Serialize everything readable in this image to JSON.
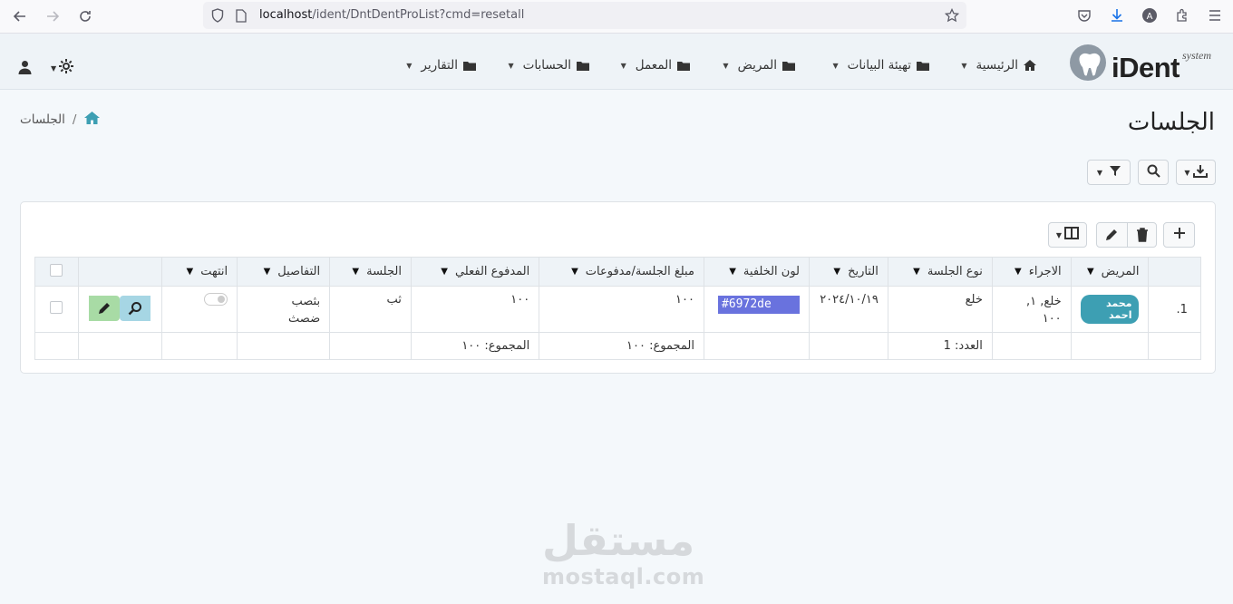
{
  "browser": {
    "url_host": "localhost",
    "url_path": "/ident/DntDentProList?cmd=resetall"
  },
  "app": {
    "logo_text": "iDent",
    "logo_sup": "system",
    "menu": [
      {
        "label": "الرئيسية"
      },
      {
        "label": "تهيئة البيانات"
      },
      {
        "label": "المريض"
      },
      {
        "label": "المعمل"
      },
      {
        "label": "الحسابات"
      },
      {
        "label": "التقارير"
      }
    ]
  },
  "page": {
    "title": "الجلسات",
    "breadcrumb_current": "الجلسات",
    "breadcrumb_sep": "/"
  },
  "table": {
    "columns": [
      "المريض",
      "الاجراء",
      "نوع الجلسة",
      "التاريخ",
      "لون الخلفية",
      "مبلغ الجلسة/مدفوعات",
      "المدفوع الفعلي",
      "الجلسة",
      "التفاصيل",
      "انتهت"
    ],
    "rows": [
      {
        "index": "1.",
        "patient": "محمد احمد",
        "procedure": "خلع, ١,\n١٠٠",
        "session_type": "خلع",
        "date": "٢٠٢٤/١٠/١٩",
        "bg_color_label": "#6972de",
        "bg_color": "#6972de",
        "amount": "١٠٠",
        "paid": "١٠٠",
        "session": "ثب",
        "details": "بثصب\nضصث"
      }
    ],
    "footer": {
      "count": "العدد: 1",
      "amount_total": "المجموع: ١٠٠",
      "paid_total": "المجموع: ١٠٠"
    }
  },
  "watermark": {
    "ar": "مستقل",
    "en": "mostaql.com"
  }
}
